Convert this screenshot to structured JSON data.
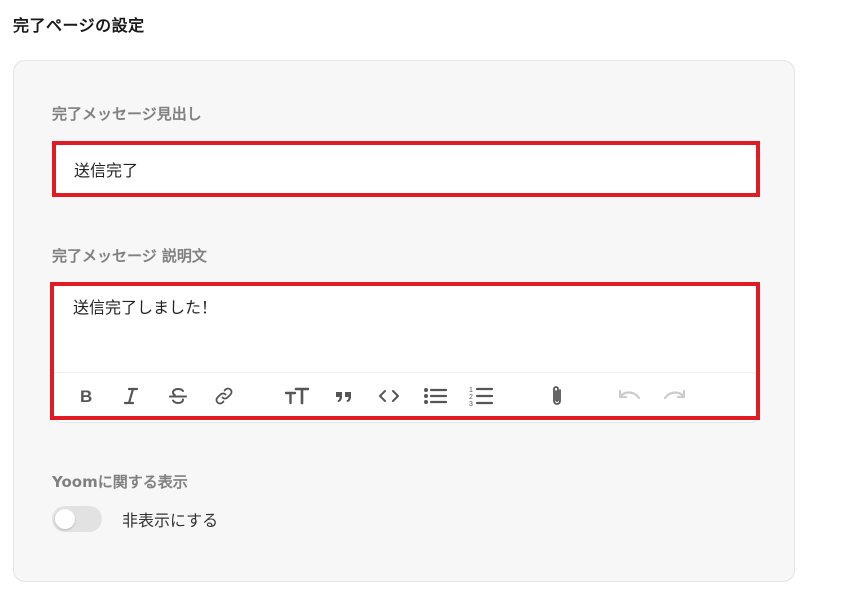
{
  "page": {
    "title": "完了ページの設定"
  },
  "form": {
    "heading_label": "完了メッセージ見出し",
    "heading_value": "送信完了",
    "description_label": "完了メッセージ 説明文",
    "description_value": "送信完了しました！",
    "toolbar": {
      "buttons": [
        "bold-icon",
        "italic-icon",
        "strikethrough-icon",
        "link-icon",
        "text-size-icon",
        "quote-icon",
        "code-icon",
        "bulleted-list-icon",
        "numbered-list-icon",
        "attachment-icon",
        "undo-icon",
        "redo-icon"
      ]
    },
    "yoom_label": "Yoomに関する表示",
    "toggle_label": "非表示にする",
    "toggle_on": false
  },
  "colors": {
    "highlight": "#e01b24",
    "panel_bg": "#f7f7f7",
    "label": "#808080"
  }
}
